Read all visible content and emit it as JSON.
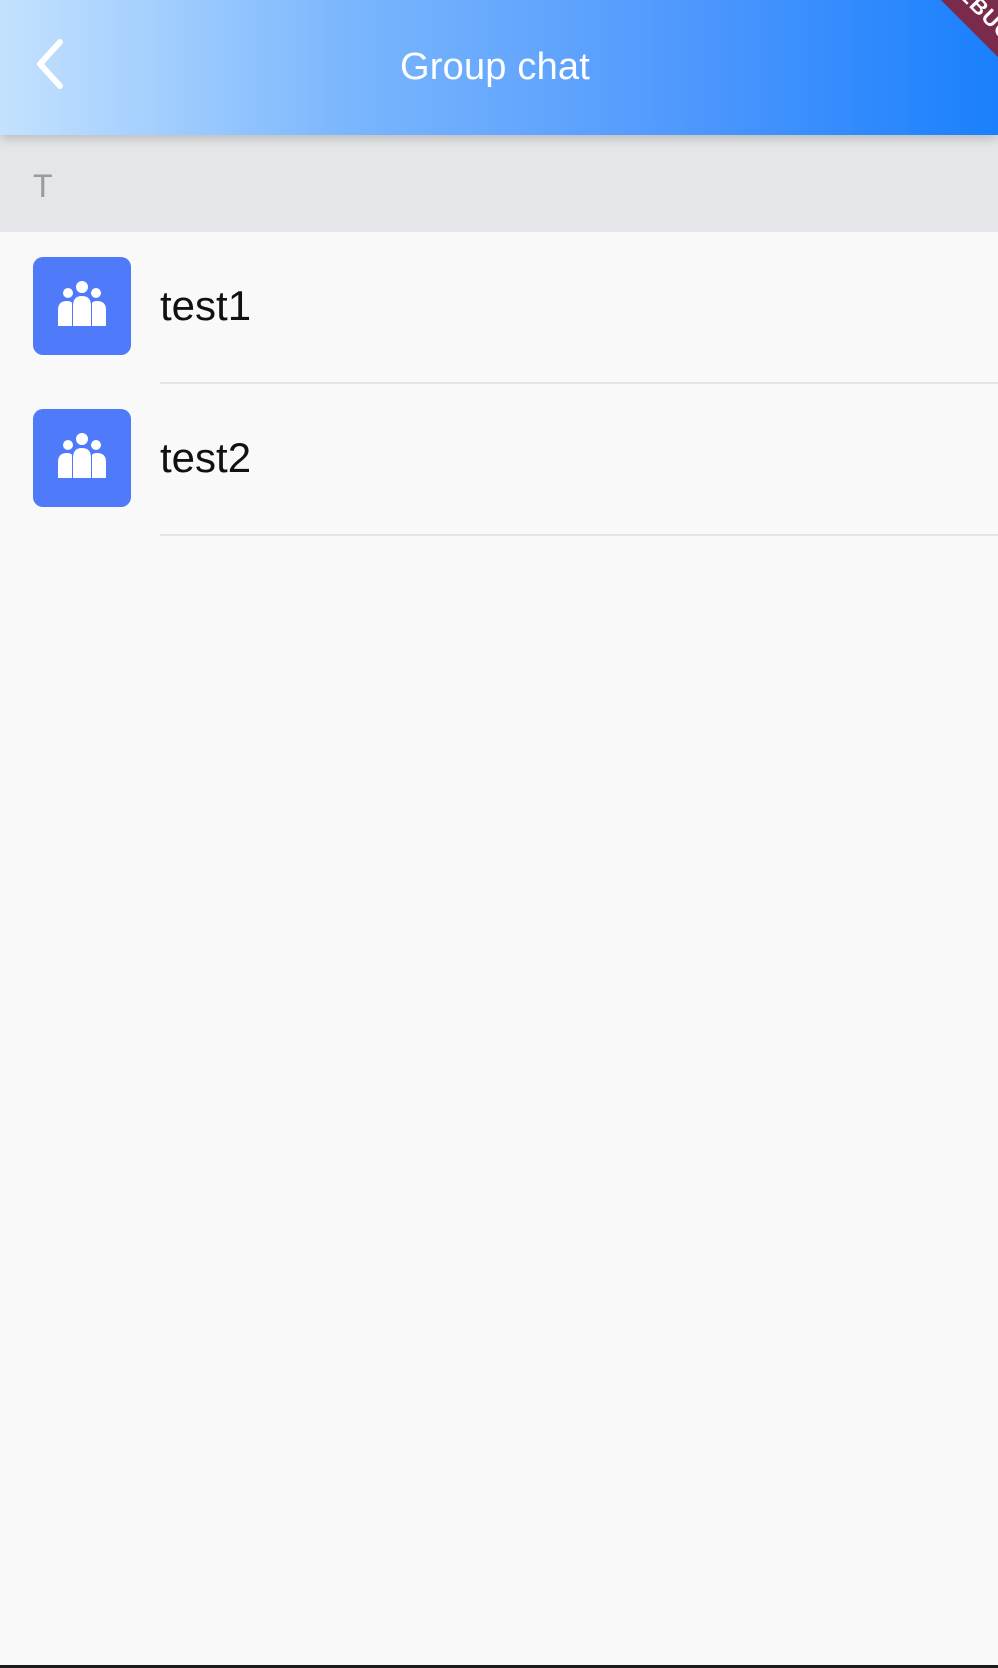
{
  "header": {
    "title": "Group chat",
    "back_icon": "chevron-left-icon",
    "gradient_colors": [
      "#c4e2fe",
      "#1a80fd"
    ]
  },
  "debug_banner": {
    "label": "DEBUG",
    "color": "#7a2b4c"
  },
  "section": {
    "letter": "T"
  },
  "list": {
    "avatar_icon": "group-icon",
    "avatar_color": "#4f7bfa",
    "items": [
      {
        "label": "test1"
      },
      {
        "label": "test2"
      }
    ]
  }
}
